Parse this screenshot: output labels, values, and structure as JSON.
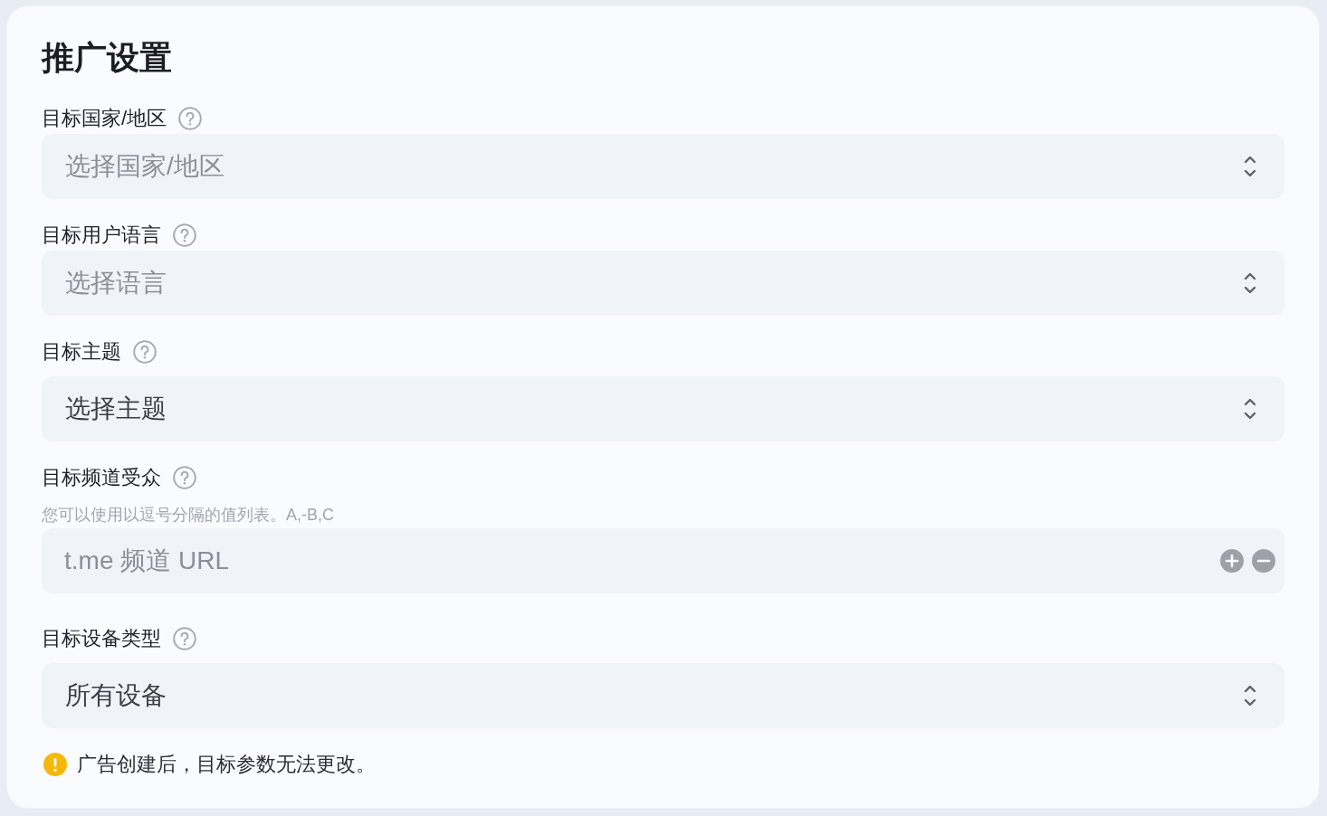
{
  "title": "推广设置",
  "fields": [
    {
      "kind": "select",
      "label": "目标国家/地区",
      "placeholder": "选择国家/地区"
    },
    {
      "kind": "select",
      "label": "目标用户语言",
      "placeholder": "选择语言"
    },
    {
      "kind": "select",
      "label": "目标主题",
      "value": "选择主题"
    },
    {
      "kind": "list_input",
      "label": "目标频道受众",
      "hint": "您可以使用以逗号分隔的值列表。A,-B,C",
      "placeholder": "t.me 频道 URL"
    },
    {
      "kind": "select",
      "label": "目标设备类型",
      "value": "所有设备"
    }
  ],
  "notice": {
    "kind": "warning",
    "text": "广告创建后，目标参数无法更改。"
  }
}
